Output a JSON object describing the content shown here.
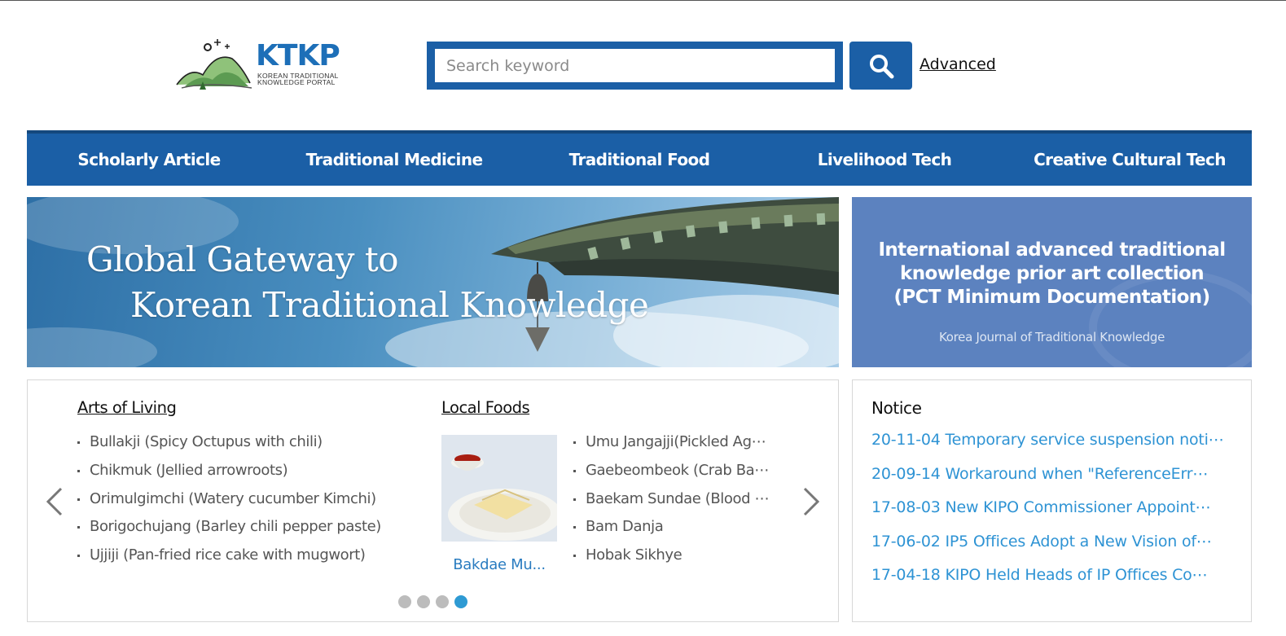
{
  "header": {
    "logo_title": "KTKP",
    "logo_subtitle_line1": "KOREAN TRADITIONAL",
    "logo_subtitle_line2": "KNOWLEDGE PORTAL",
    "search_placeholder": "Search keyword",
    "search_icon": "search-icon",
    "advanced_label": "Advanced"
  },
  "nav": {
    "items": [
      {
        "label": "Scholarly Article"
      },
      {
        "label": "Traditional Medicine"
      },
      {
        "label": "Traditional Food"
      },
      {
        "label": "Livelihood Tech"
      },
      {
        "label": "Creative Cultural Tech"
      }
    ]
  },
  "banner": {
    "line1": "Global Gateway to",
    "line2": "Korean Traditional Knowledge"
  },
  "side_banner": {
    "title_line1": "International advanced traditional",
    "title_line2": "knowledge prior art collection",
    "title_line3": "(PCT Minimum Documentation)",
    "subtitle": "Korea Journal of Traditional Knowledge"
  },
  "arts_of_living": {
    "title": "Arts of Living",
    "items": [
      "Bullakji (Spicy Octupus with chili)",
      "Chikmuk (Jellied arrowroots)",
      "Orimulgimchi (Watery cucumber Kimchi)",
      "Borigochujang (Barley chili pepper paste)",
      "Ujjiji (Pan-fried rice cake with mugwort)"
    ]
  },
  "local_foods": {
    "title": "Local Foods",
    "featured_caption": "Bakdae Mu...",
    "items": [
      "Umu Jangajji(Pickled Ag⋯",
      "Gaebeombeok (Crab Ba⋯",
      "Baekam Sundae (Blood ⋯",
      "Bam Danja",
      "Hobak Sikhye"
    ]
  },
  "carousel": {
    "page_count": 4,
    "active_page": 4,
    "prev_icon": "chevron-left-icon",
    "next_icon": "chevron-right-icon"
  },
  "notice": {
    "title": "Notice",
    "items": [
      "20-11-04 Temporary service suspension noti⋯",
      "20-09-14 Workaround when \"ReferenceErr⋯",
      "17-08-03 New KIPO Commissioner Appoint⋯",
      "17-06-02 IP5 Offices Adopt a New Vision of⋯",
      "17-04-18 KIPO Held Heads of IP Offices Co⋯"
    ]
  },
  "colors": {
    "primary_blue": "#1b5fa6",
    "nav_border": "#14487d",
    "side_banner": "#5c82bf",
    "link_blue": "#2e93d4",
    "active_dot": "#2e9ad3"
  }
}
